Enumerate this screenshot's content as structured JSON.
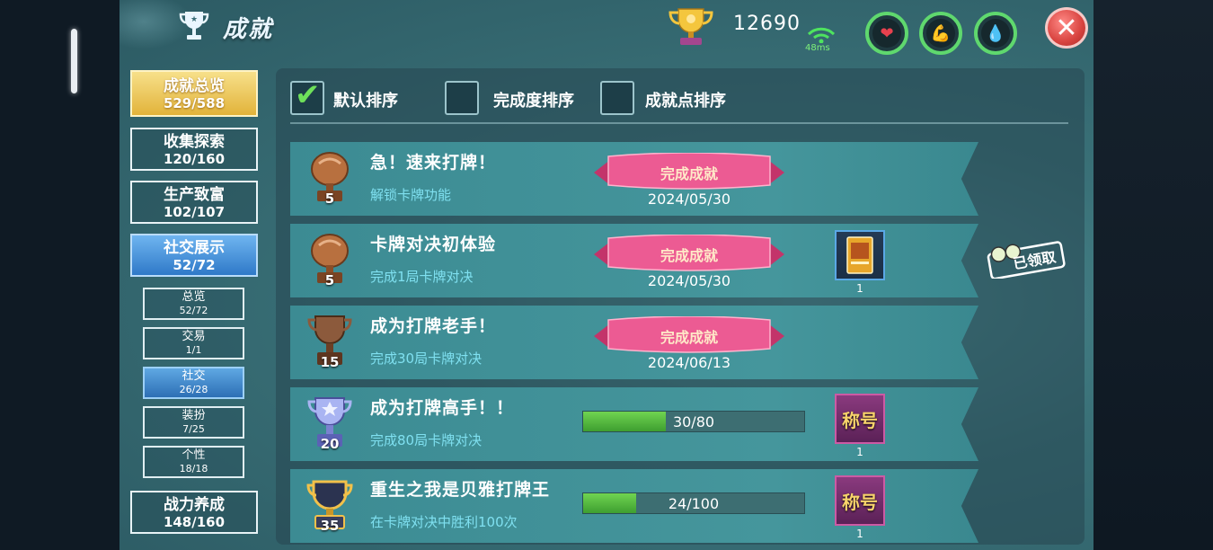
{
  "header": {
    "title": "成就",
    "score": "12690",
    "ping": "48ms",
    "close_symbol": "✕"
  },
  "stats": [
    {
      "name": "heart",
      "icon": "❤",
      "color": "#e8414e"
    },
    {
      "name": "arm",
      "icon": "💪",
      "color": "#f2b233"
    },
    {
      "name": "drop",
      "icon": "💧",
      "color": "#3ec4d6"
    }
  ],
  "nav": [
    {
      "label": "成就总览",
      "count": "529/588"
    },
    {
      "label": "收集探索",
      "count": "120/160"
    },
    {
      "label": "生产致富",
      "count": "102/107"
    },
    {
      "label": "社交展示",
      "count": "52/72"
    },
    {
      "label": "战力养成",
      "count": "148/160"
    }
  ],
  "subnav": [
    {
      "label": "总览",
      "count": "52/72"
    },
    {
      "label": "交易",
      "count": "1/1"
    },
    {
      "label": "社交",
      "count": "26/28"
    },
    {
      "label": "装扮",
      "count": "7/25"
    },
    {
      "label": "个性",
      "count": "18/18"
    }
  ],
  "sort": [
    {
      "label": "默认排序",
      "checked": true
    },
    {
      "label": "完成度排序",
      "checked": false
    },
    {
      "label": "成就点排序",
      "checked": false
    }
  ],
  "achievements": [
    {
      "title": "急！速来打牌！",
      "desc": "解锁卡牌功能",
      "points": "5",
      "status": "完成成就",
      "date": "2024/05/30"
    },
    {
      "title": "卡牌对决初体验",
      "desc": "完成1局卡牌对决",
      "points": "5",
      "status": "完成成就",
      "date": "2024/05/30",
      "reward_count": "1",
      "claimed": "已领取"
    },
    {
      "title": "成为打牌老手！",
      "desc": "完成30局卡牌对决",
      "points": "15",
      "status": "完成成就",
      "date": "2024/06/13"
    },
    {
      "title": "成为打牌高手！！",
      "desc": "完成80局卡牌对决",
      "points": "20",
      "progress": "30/80",
      "progress_ratio": 0.375,
      "reward_label": "称号",
      "reward_count": "1"
    },
    {
      "title": "重生之我是贝雅打牌王",
      "desc": "在卡牌对决中胜利100次",
      "points": "35",
      "progress": "24/100",
      "progress_ratio": 0.24,
      "reward_label": "称号",
      "reward_count": "1"
    }
  ]
}
